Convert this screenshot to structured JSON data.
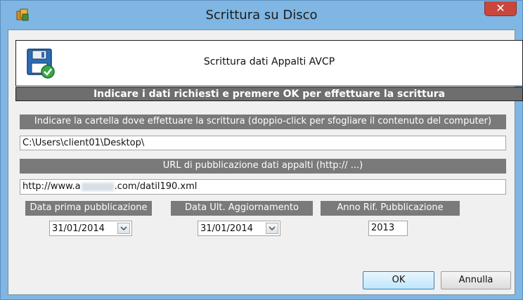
{
  "window": {
    "title": "Scrittura su Disco",
    "close_glyph": "✕"
  },
  "header": {
    "subtitle": "Scrittura dati Appalti AVCP",
    "icon": "save-disk-check-icon"
  },
  "banner": {
    "text": "Indicare i dati richiesti e premere OK per effettuare la scrittura"
  },
  "folder": {
    "label": "Indicare la cartella dove effettuare la scrittura (doppio-click per sfogliare il contenuto del computer)",
    "value": "C:\\Users\\client01\\Desktop\\"
  },
  "url": {
    "label": "URL di pubblicazione dati appalti (http:// ...)",
    "value_prefix": "http://www.a",
    "value_suffix": ".com/datil190.xml"
  },
  "dates": {
    "first_pub_label": "Data prima pubblicazione",
    "first_pub_value": "31/01/2014",
    "last_update_label": "Data Ult. Aggiornamento",
    "last_update_value": "31/01/2014",
    "year_label": "Anno Rif. Pubblicazione",
    "year_value": "2013"
  },
  "buttons": {
    "ok": "OK",
    "cancel": "Annulla"
  },
  "colors": {
    "titlebar": "#7fb6e3",
    "close": "#c9463d",
    "label_bar": "#7a7a7a",
    "banner": "#6e6e6e"
  }
}
